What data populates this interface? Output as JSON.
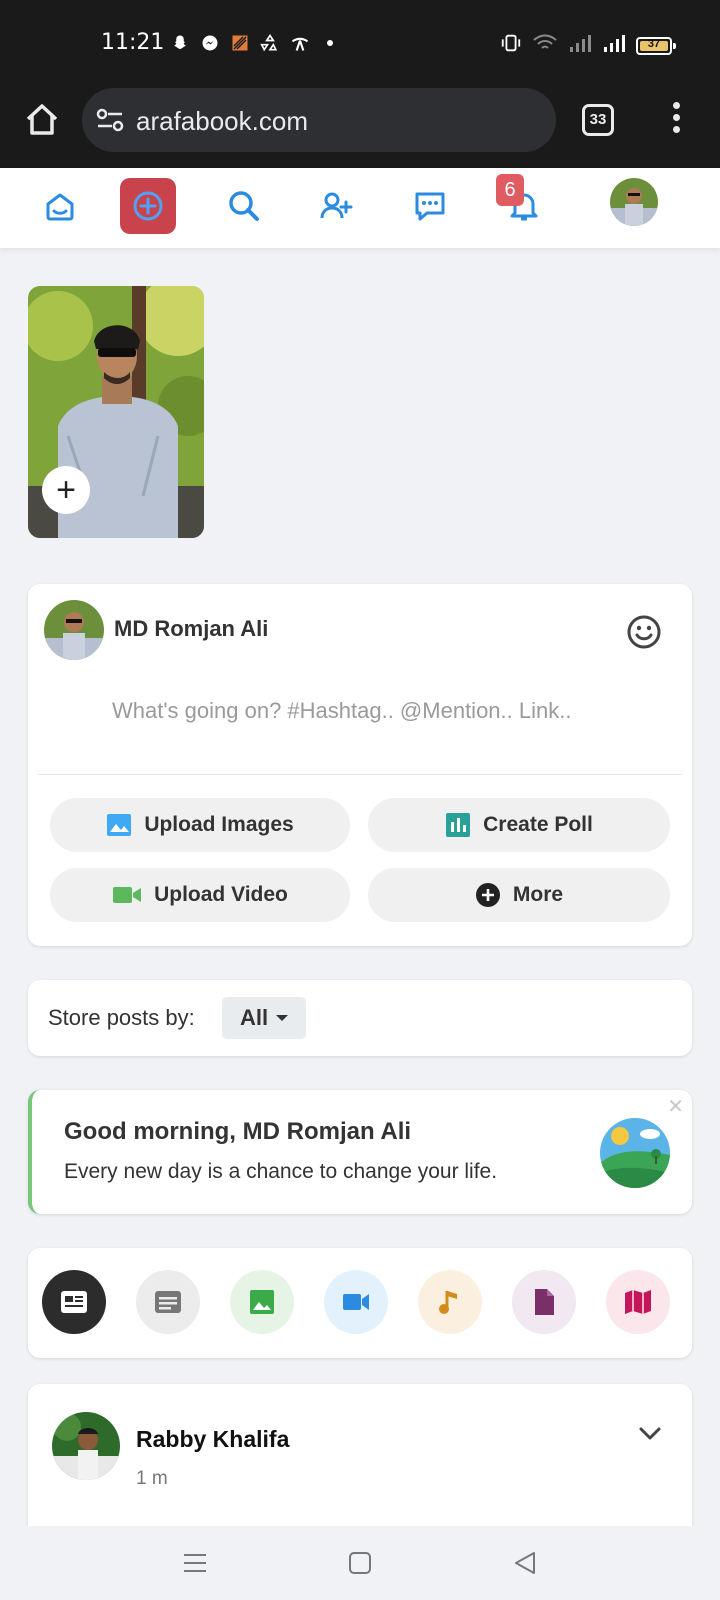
{
  "status_bar": {
    "time": "11:21",
    "battery_level": "37"
  },
  "browser": {
    "url": "arafabook.com",
    "tab_count": "33"
  },
  "nav": {
    "notifications_count": "6"
  },
  "composer": {
    "user_name": "MD Romjan Ali",
    "placeholder": "What's going on? #Hashtag.. @Mention.. Link..",
    "actions": [
      {
        "label": "Upload Images",
        "icon": "image-icon",
        "color": "#3fa9f5"
      },
      {
        "label": "Create Poll",
        "icon": "poll-icon",
        "color": "#2aa198"
      },
      {
        "label": "Upload Video",
        "icon": "video-camera-icon",
        "color": "#5cb85c"
      },
      {
        "label": "More",
        "icon": "plus-circle-icon",
        "color": "#222222"
      }
    ]
  },
  "store_posts": {
    "label": "Store posts by:",
    "selected": "All"
  },
  "greeting": {
    "title": "Good morning, MD Romjan Ali",
    "message": "Every new day is a chance to change your life.",
    "close_label": "✕"
  },
  "post_types": [
    {
      "icon": "news-feed-icon",
      "bg": "#2c2c2c",
      "fg": "#ffffff"
    },
    {
      "icon": "text-post-icon",
      "bg": "#ececec",
      "fg": "#777777"
    },
    {
      "icon": "photo-icon",
      "bg": "#e6f4e6",
      "fg": "#3bab4a"
    },
    {
      "icon": "video-icon",
      "bg": "#e3f1fc",
      "fg": "#2a8be0"
    },
    {
      "icon": "music-icon",
      "bg": "#fbf0e0",
      "fg": "#d48a1c"
    },
    {
      "icon": "file-icon",
      "bg": "#f1e8f1",
      "fg": "#7a2f6b"
    },
    {
      "icon": "map-icon",
      "bg": "#fbe6ec",
      "fg": "#c2185b"
    }
  ],
  "post": {
    "author": "Rabby Khalifa",
    "time": "1 m"
  }
}
